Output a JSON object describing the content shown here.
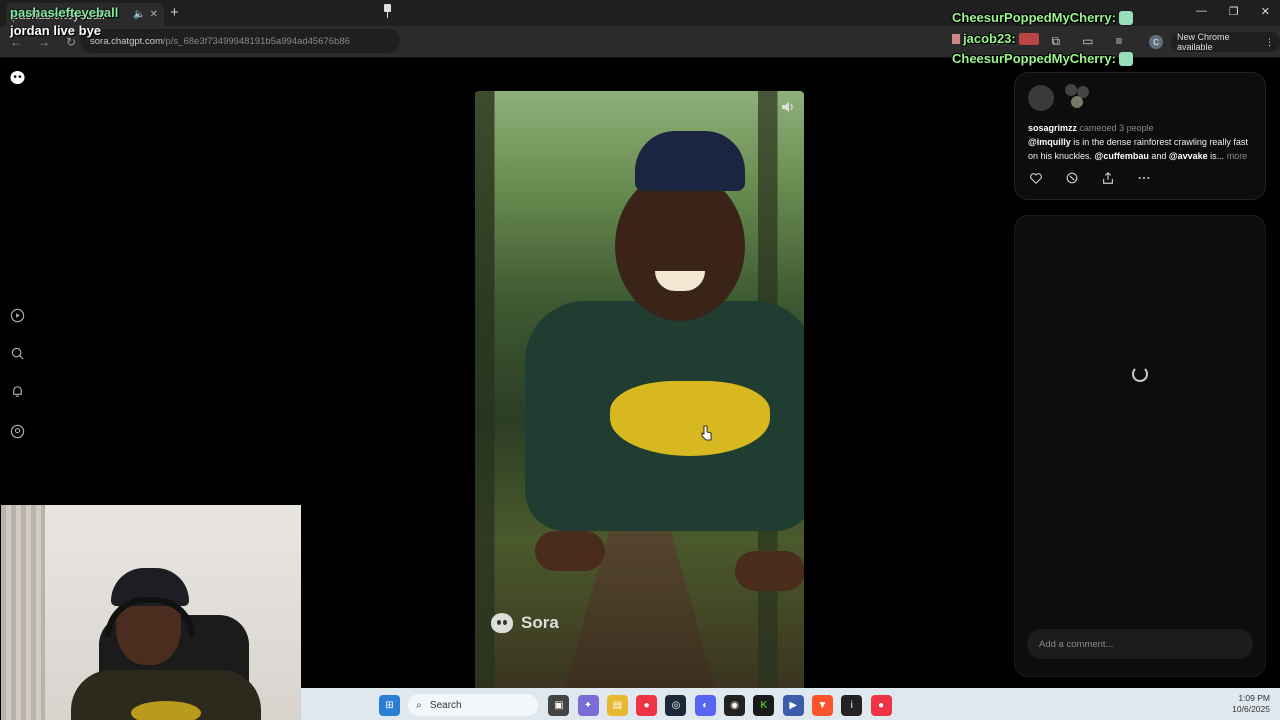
{
  "browser": {
    "tab_title": "pashaslefteyeball",
    "new_tab": "+",
    "url_host": "sora.chatgpt.com",
    "url_path": "/p/s_68e3f73499948191b5a994ad45676b86",
    "new_chrome": "New Chrome available",
    "profile_letter": "C"
  },
  "stream": {
    "title": "pashaslefteyeball",
    "subtitle": "jordan live bye",
    "chat": [
      "CheesurPoppedMyCherry:",
      "jacob23:",
      "CheesurPoppedMyCherry:"
    ]
  },
  "video": {
    "watermark": "Sora"
  },
  "post": {
    "username": "sosagrimzz",
    "cameo_text": "cameoed 3 people",
    "mention1": "@imquilly",
    "desc1": " is in the dense rainforest crawling really fast on his knuckles. ",
    "mention2": "@cuffembau",
    "and_text": " and ",
    "mention3": "@avvake",
    "desc2": " is... ",
    "more": "more"
  },
  "comments": {
    "placeholder": "Add a comment..."
  },
  "taskbar": {
    "search": "Search",
    "time": "1:09 PM",
    "date": "10/6/2025"
  },
  "colors": {
    "chat_green": "#9bf58c",
    "title_green": "#7fe9a0",
    "taskbar_bg": "#dfe8ef"
  }
}
